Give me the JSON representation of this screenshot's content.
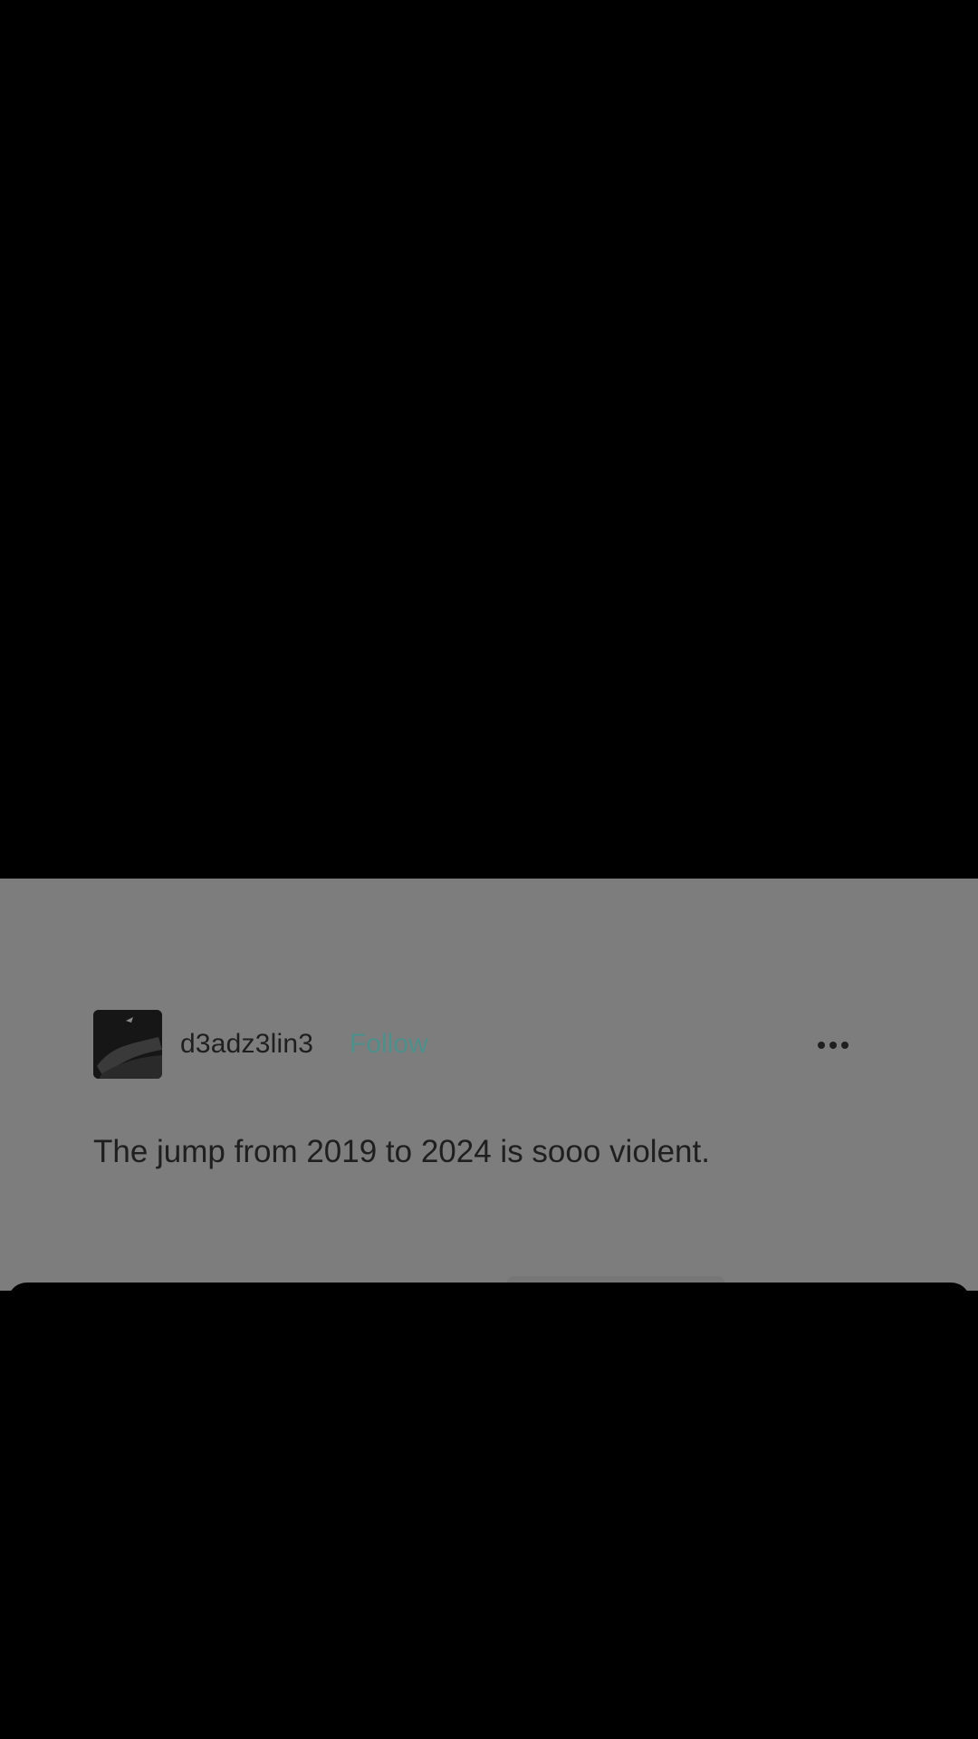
{
  "post": {
    "username": "d3adz3lin3",
    "follow_label": "Follow",
    "more_icon": "more-horizontal-icon",
    "text": "The jump from 2019 to 2024 is sooo violent."
  },
  "colors": {
    "card_background": "#7d7d7d",
    "follow_accent": "#4f8f8b",
    "text": "#1f1f1f",
    "backdrop": "#000000"
  }
}
